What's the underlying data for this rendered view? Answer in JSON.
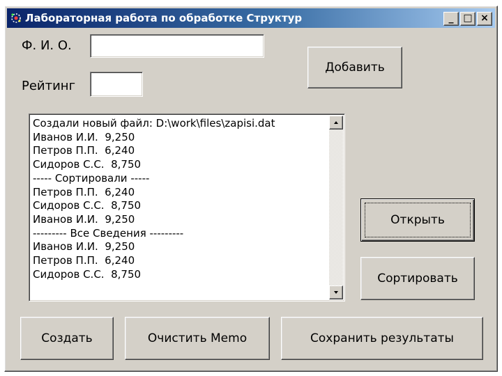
{
  "window": {
    "title": "Лабораторная работа по обработке Структур",
    "controls": {
      "minimize": "_",
      "maximize": "□",
      "close": "×"
    }
  },
  "form": {
    "fio_label": "Ф. И. О.",
    "fio_value": "",
    "rating_label": "Рейтинг",
    "rating_value": ""
  },
  "buttons": {
    "add": "Добавить",
    "open": "Открыть",
    "sort": "Сортировать",
    "create": "Создать",
    "clear_memo": "Очистить Memo",
    "save_results": "Сохранить результаты"
  },
  "memo": {
    "lines": [
      "Создали новый файл: D:\\work\\files\\zapisi.dat",
      "Иванов И.И.  9,250",
      "Петров П.П.  6,240",
      "Сидоров С.С.  8,750",
      "----- Сортировали -----",
      "Петров П.П.  6,240",
      "Сидоров С.С.  8,750",
      "Иванов И.И.  9,250",
      "--------- Все Сведения ---------",
      "Иванов И.И.  9,250",
      "Петров П.П.  6,240",
      "Сидоров С.С.  8,750"
    ]
  },
  "icons": {
    "title": "app-icon",
    "scroll_up": "arrow-up-icon",
    "scroll_down": "arrow-down-icon"
  }
}
